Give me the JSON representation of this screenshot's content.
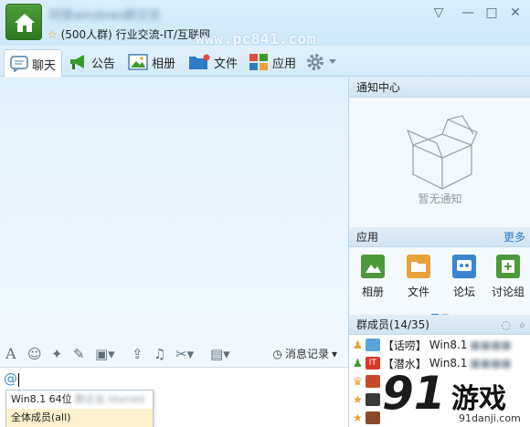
{
  "window": {
    "group_name": "阿里windows群交流",
    "group_meta_star": "☆",
    "group_meta": "(500人群) 行业交流-IT/互联网",
    "watermark": "www.pc841.com",
    "controls": [
      "▽",
      "—",
      "□",
      "✕"
    ]
  },
  "tabs": [
    {
      "label": "聊天",
      "icon": "chat-bubble-icon",
      "active": true
    },
    {
      "label": "公告",
      "icon": "megaphone-icon"
    },
    {
      "label": "相册",
      "icon": "photo-icon"
    },
    {
      "label": "文件",
      "icon": "folder-icon"
    },
    {
      "label": "应用",
      "icon": "apps-grid-icon"
    },
    {
      "label": "",
      "icon": "gear-icon"
    }
  ],
  "chat_toolbar": {
    "history_label": "消息记录"
  },
  "input": {
    "text": "@"
  },
  "mention_popup": {
    "items": [
      {
        "prefix": "Win8.1 64位",
        "blurred": "群主名 blurred"
      },
      {
        "prefix": "全体成员(all)",
        "blurred": ""
      }
    ]
  },
  "right_panel": {
    "notify_title": "通知中心",
    "notify_empty": "暂无通知",
    "apps_title": "应用",
    "apps_more": "更多",
    "apps": [
      {
        "label": "相册",
        "color": "#4c9a3a"
      },
      {
        "label": "文件",
        "color": "#e8a23a"
      },
      {
        "label": "论坛",
        "color": "#3a86d0"
      },
      {
        "label": "讨论组",
        "color": "#4c9a3a"
      }
    ],
    "members_title": "群成员(14/35)",
    "members": [
      {
        "tag": "【话唠】",
        "name": "Win8.1"
      },
      {
        "tag": "【潜水】",
        "name": "Win8.1"
      }
    ]
  },
  "logo": {
    "number": "91",
    "cn": "游戏",
    "url": "91danji.com"
  },
  "colors": {
    "accent": "#3a86d0",
    "tab_bg": "#d4e9f7"
  }
}
